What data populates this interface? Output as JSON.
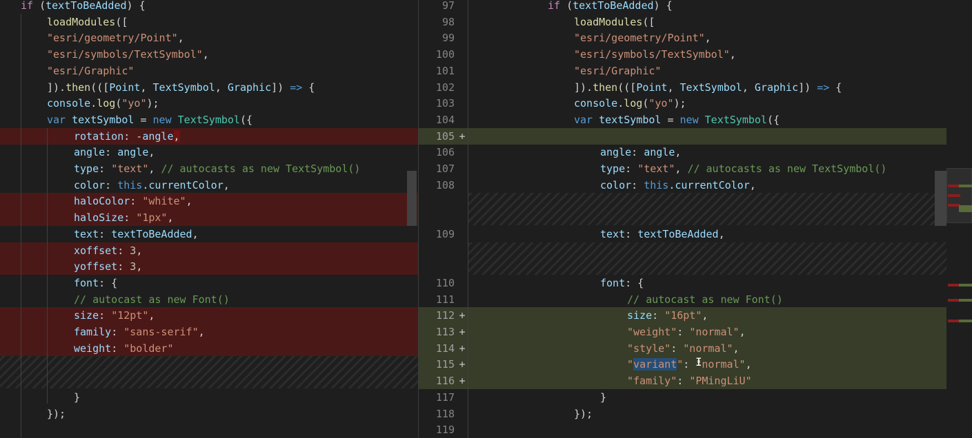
{
  "left": {
    "lines": [
      {
        "tokens": [
          [
            "ctl",
            "if"
          ],
          [
            "pn",
            " ("
          ],
          [
            "vr",
            "textToBeAdded"
          ],
          [
            "pn",
            ") {"
          ]
        ],
        "indent": 30
      },
      {
        "tokens": [
          [
            "fn",
            "loadModules"
          ],
          [
            "pn",
            "(["
          ]
        ],
        "indent": 68
      },
      {
        "tokens": [
          [
            "st",
            "\"esri/geometry/Point\""
          ],
          [
            "pn",
            ","
          ]
        ],
        "indent": 68
      },
      {
        "tokens": [
          [
            "st",
            "\"esri/symbols/TextSymbol\""
          ],
          [
            "pn",
            ","
          ]
        ],
        "indent": 68
      },
      {
        "tokens": [
          [
            "st",
            "\"esri/Graphic\""
          ]
        ],
        "indent": 68
      },
      {
        "tokens": [
          [
            "pn",
            "])."
          ],
          [
            "fn",
            "then"
          ],
          [
            "pn",
            "((["
          ],
          [
            "vr",
            "Point"
          ],
          [
            "pn",
            ", "
          ],
          [
            "vr",
            "TextSymbol"
          ],
          [
            "pn",
            ", "
          ],
          [
            "vr",
            "Graphic"
          ],
          [
            "pn",
            "]) "
          ],
          [
            "kw",
            "=>"
          ],
          [
            "pn",
            " {"
          ]
        ],
        "indent": 68
      },
      {
        "tokens": [
          [
            "vr",
            "console"
          ],
          [
            "pn",
            "."
          ],
          [
            "fn",
            "log"
          ],
          [
            "pn",
            "("
          ],
          [
            "st",
            "\"yo\""
          ],
          [
            "pn",
            ");"
          ]
        ],
        "indent": 68
      },
      {
        "tokens": [
          [
            "kw",
            "var"
          ],
          [
            "pn",
            " "
          ],
          [
            "vr",
            "textSymbol"
          ],
          [
            "pn",
            " = "
          ],
          [
            "kw",
            "new"
          ],
          [
            "pn",
            " "
          ],
          [
            "ty",
            "TextSymbol"
          ],
          [
            "pn",
            "({"
          ]
        ],
        "indent": 68
      },
      {
        "tokens": [
          [
            "vr",
            "rotation"
          ],
          [
            "pn",
            ": -"
          ],
          [
            "vr",
            "angle"
          ],
          [
            "pn",
            ","
          ]
        ],
        "indent": 107,
        "state": "removed",
        "hl": true
      },
      {
        "tokens": [
          [
            "vr",
            "angle"
          ],
          [
            "pn",
            ": "
          ],
          [
            "vr",
            "angle"
          ],
          [
            "pn",
            ","
          ]
        ],
        "indent": 107
      },
      {
        "tokens": [
          [
            "vr",
            "type"
          ],
          [
            "pn",
            ": "
          ],
          [
            "st",
            "\"text\""
          ],
          [
            "pn",
            ", "
          ],
          [
            "cm",
            "// autocasts as new TextSymbol()"
          ]
        ],
        "indent": 107
      },
      {
        "tokens": [
          [
            "vr",
            "color"
          ],
          [
            "pn",
            ": "
          ],
          [
            "kw",
            "this"
          ],
          [
            "pn",
            "."
          ],
          [
            "vr",
            "currentColor"
          ],
          [
            "pn",
            ","
          ]
        ],
        "indent": 107
      },
      {
        "tokens": [
          [
            "vr",
            "haloColor"
          ],
          [
            "pn",
            ": "
          ],
          [
            "st",
            "\"white\""
          ],
          [
            "pn",
            ","
          ]
        ],
        "indent": 107,
        "state": "removed"
      },
      {
        "tokens": [
          [
            "vr",
            "haloSize"
          ],
          [
            "pn",
            ": "
          ],
          [
            "st",
            "\"1px\""
          ],
          [
            "pn",
            ","
          ]
        ],
        "indent": 107,
        "state": "removed"
      },
      {
        "tokens": [
          [
            "vr",
            "text"
          ],
          [
            "pn",
            ": "
          ],
          [
            "vr",
            "textToBeAdded"
          ],
          [
            "pn",
            ","
          ]
        ],
        "indent": 107
      },
      {
        "tokens": [
          [
            "vr",
            "xoffset"
          ],
          [
            "pn",
            ": "
          ],
          [
            "nm",
            "3"
          ],
          [
            "pn",
            ","
          ]
        ],
        "indent": 107,
        "state": "removed"
      },
      {
        "tokens": [
          [
            "vr",
            "yoffset"
          ],
          [
            "pn",
            ": "
          ],
          [
            "nm",
            "3"
          ],
          [
            "pn",
            ","
          ]
        ],
        "indent": 107,
        "state": "removed"
      },
      {
        "tokens": [
          [
            "vr",
            "font"
          ],
          [
            "pn",
            ": {"
          ]
        ],
        "indent": 107
      },
      {
        "tokens": [
          [
            "cm",
            "// autocast as new Font()"
          ]
        ],
        "indent": 107
      },
      {
        "tokens": [
          [
            "vr",
            "size"
          ],
          [
            "pn",
            ": "
          ],
          [
            "st",
            "\"12pt\""
          ],
          [
            "pn",
            ","
          ]
        ],
        "indent": 107,
        "state": "removed"
      },
      {
        "tokens": [
          [
            "vr",
            "family"
          ],
          [
            "pn",
            ": "
          ],
          [
            "st",
            "\"sans-serif\""
          ],
          [
            "pn",
            ","
          ]
        ],
        "indent": 107,
        "state": "removed"
      },
      {
        "tokens": [
          [
            "vr",
            "weight"
          ],
          [
            "pn",
            ": "
          ],
          [
            "st",
            "\"bolder\""
          ]
        ],
        "indent": 107,
        "state": "removed"
      },
      {
        "tokens": [],
        "indent": 0,
        "state": "filler"
      },
      {
        "tokens": [],
        "indent": 0,
        "state": "filler"
      },
      {
        "tokens": [
          [
            "pn",
            "}"
          ]
        ],
        "indent": 107
      },
      {
        "tokens": [
          [
            "pn",
            "});"
          ]
        ],
        "indent": 68
      }
    ]
  },
  "right": {
    "lines": [
      {
        "num": "97",
        "tokens": [
          [
            "ctl",
            "if"
          ],
          [
            "pn",
            " ("
          ],
          [
            "vr",
            "textToBeAdded"
          ],
          [
            "pn",
            ") {"
          ]
        ],
        "indent": 794
      },
      {
        "num": "98",
        "tokens": [
          [
            "fn",
            "loadModules"
          ],
          [
            "pn",
            "(["
          ]
        ],
        "indent": 832
      },
      {
        "num": "99",
        "tokens": [
          [
            "st",
            "\"esri/geometry/Point\""
          ],
          [
            "pn",
            ","
          ]
        ],
        "indent": 832
      },
      {
        "num": "100",
        "tokens": [
          [
            "st",
            "\"esri/symbols/TextSymbol\""
          ],
          [
            "pn",
            ","
          ]
        ],
        "indent": 832
      },
      {
        "num": "101",
        "tokens": [
          [
            "st",
            "\"esri/Graphic\""
          ]
        ],
        "indent": 832
      },
      {
        "num": "102",
        "tokens": [
          [
            "pn",
            "])."
          ],
          [
            "fn",
            "then"
          ],
          [
            "pn",
            "((["
          ],
          [
            "vr",
            "Point"
          ],
          [
            "pn",
            ", "
          ],
          [
            "vr",
            "TextSymbol"
          ],
          [
            "pn",
            ", "
          ],
          [
            "vr",
            "Graphic"
          ],
          [
            "pn",
            "]) "
          ],
          [
            "kw",
            "=>"
          ],
          [
            "pn",
            " {"
          ]
        ],
        "indent": 832
      },
      {
        "num": "103",
        "tokens": [
          [
            "vr",
            "console"
          ],
          [
            "pn",
            "."
          ],
          [
            "fn",
            "log"
          ],
          [
            "pn",
            "("
          ],
          [
            "st",
            "\"yo\""
          ],
          [
            "pn",
            ");"
          ]
        ],
        "indent": 832
      },
      {
        "num": "104",
        "tokens": [
          [
            "kw",
            "var"
          ],
          [
            "pn",
            " "
          ],
          [
            "vr",
            "textSymbol"
          ],
          [
            "pn",
            " = "
          ],
          [
            "kw",
            "new"
          ],
          [
            "pn",
            " "
          ],
          [
            "ty",
            "TextSymbol"
          ],
          [
            "pn",
            "({"
          ]
        ],
        "indent": 832
      },
      {
        "num": "105",
        "tokens": [],
        "indent": 870,
        "state": "added",
        "mark": "+"
      },
      {
        "num": "106",
        "tokens": [
          [
            "vr",
            "angle"
          ],
          [
            "pn",
            ": "
          ],
          [
            "vr",
            "angle"
          ],
          [
            "pn",
            ","
          ]
        ],
        "indent": 870
      },
      {
        "num": "107",
        "tokens": [
          [
            "vr",
            "type"
          ],
          [
            "pn",
            ": "
          ],
          [
            "st",
            "\"text\""
          ],
          [
            "pn",
            ", "
          ],
          [
            "cm",
            "// autocasts as new TextSymbol()"
          ]
        ],
        "indent": 870
      },
      {
        "num": "108",
        "tokens": [
          [
            "vr",
            "color"
          ],
          [
            "pn",
            ": "
          ],
          [
            "kw",
            "this"
          ],
          [
            "pn",
            "."
          ],
          [
            "vr",
            "currentColor"
          ],
          [
            "pn",
            ","
          ]
        ],
        "indent": 870
      },
      {
        "num": "",
        "tokens": [],
        "indent": 0,
        "state": "filler"
      },
      {
        "num": "",
        "tokens": [],
        "indent": 0,
        "state": "filler"
      },
      {
        "num": "109",
        "tokens": [
          [
            "vr",
            "text"
          ],
          [
            "pn",
            ": "
          ],
          [
            "vr",
            "textToBeAdded"
          ],
          [
            "pn",
            ","
          ]
        ],
        "indent": 870
      },
      {
        "num": "",
        "tokens": [],
        "indent": 0,
        "state": "filler"
      },
      {
        "num": "",
        "tokens": [],
        "indent": 0,
        "state": "filler"
      },
      {
        "num": "110",
        "tokens": [
          [
            "vr",
            "font"
          ],
          [
            "pn",
            ": {"
          ]
        ],
        "indent": 870
      },
      {
        "num": "111",
        "tokens": [
          [
            "cm",
            "// autocast as new Font()"
          ]
        ],
        "indent": 909
      },
      {
        "num": "112",
        "tokens": [
          [
            "vr",
            "size"
          ],
          [
            "pn",
            ": "
          ],
          [
            "st",
            "\"16pt\""
          ],
          [
            "pn",
            ","
          ]
        ],
        "indent": 909,
        "state": "added",
        "mark": "+"
      },
      {
        "num": "113",
        "tokens": [
          [
            "st",
            "\"weight\""
          ],
          [
            "pn",
            ": "
          ],
          [
            "st",
            "\"normal\""
          ],
          [
            "pn",
            ","
          ]
        ],
        "indent": 909,
        "state": "added",
        "mark": "+"
      },
      {
        "num": "114",
        "tokens": [
          [
            "st",
            "\"style\""
          ],
          [
            "pn",
            ": "
          ],
          [
            "st",
            "\"normal\""
          ],
          [
            "pn",
            ","
          ]
        ],
        "indent": 909,
        "state": "added",
        "mark": "+"
      },
      {
        "num": "115",
        "tokens": [
          [
            "st",
            "\""
          ],
          [
            "sel",
            "variant"
          ],
          [
            "st",
            "\""
          ],
          [
            "pn",
            ": "
          ],
          [
            "st",
            "\"normal\""
          ],
          [
            "pn",
            ","
          ]
        ],
        "indent": 909,
        "state": "added",
        "mark": "+"
      },
      {
        "num": "116",
        "tokens": [
          [
            "st",
            "\"family\""
          ],
          [
            "pn",
            ": "
          ],
          [
            "st",
            "\"PMingLiU\""
          ]
        ],
        "indent": 909,
        "state": "added",
        "mark": "+"
      },
      {
        "num": "117",
        "tokens": [
          [
            "pn",
            "}"
          ]
        ],
        "indent": 870
      },
      {
        "num": "118",
        "tokens": [
          [
            "pn",
            "});"
          ]
        ],
        "indent": 832
      },
      {
        "num": "119",
        "tokens": [],
        "indent": 832
      }
    ]
  },
  "colors": {
    "removed_line": "#4b1818",
    "removed_char": "#6f1313",
    "added_line": "#373d29",
    "added_char": "#3e4a2a",
    "selection": "#264f78"
  },
  "icons": {
    "text_cursor": "ibeam-icon"
  }
}
